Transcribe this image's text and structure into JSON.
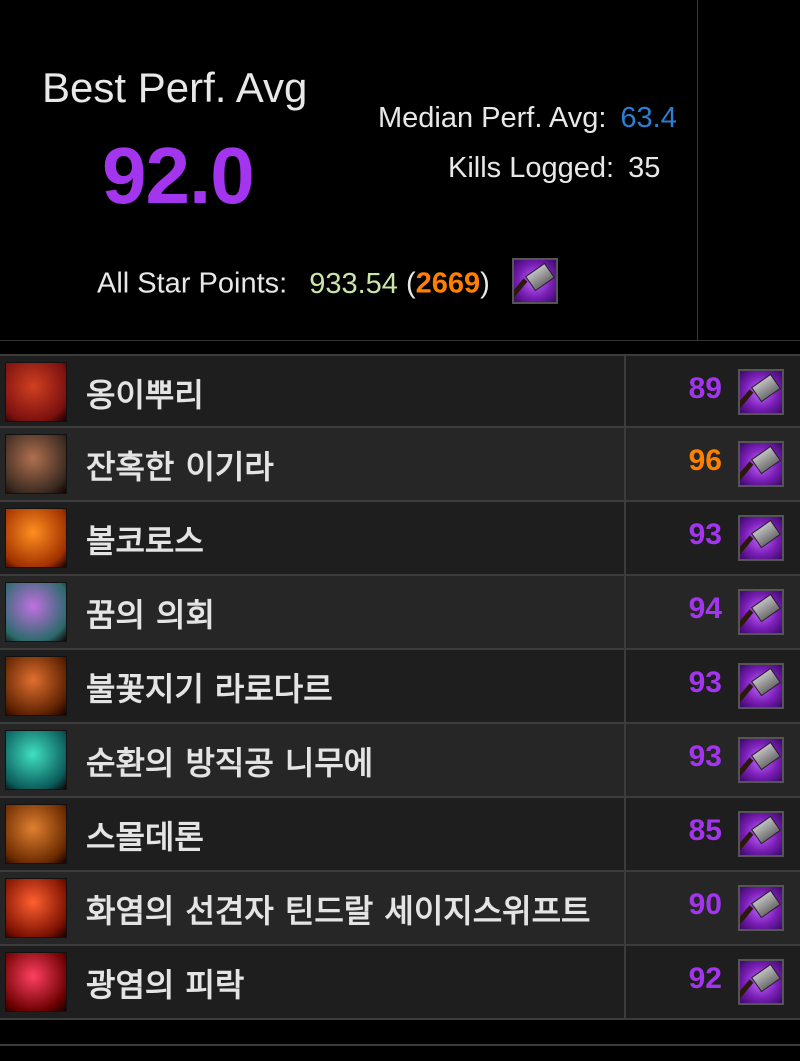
{
  "header": {
    "best_label": "Best Perf. Avg",
    "best_value": "92.0",
    "median_label": "Median Perf. Avg:",
    "median_value": "63.4",
    "kills_label": "Kills Logged:",
    "kills_value": "35",
    "asp_label": "All Star Points:",
    "asp_points": "933.54",
    "asp_rank": "2669",
    "asp_open": "(",
    "asp_close": ")",
    "spec_icon": "hammer-icon"
  },
  "colors": {
    "legendary": "#ff8000",
    "epic": "#a335ee",
    "rare": "#2a7fd4",
    "points": "#c9e6a8"
  },
  "bosses": [
    {
      "name": "옹이뿌리",
      "score": "89",
      "color": "#a335ee",
      "icon": "boss-portrait-icon"
    },
    {
      "name": "잔혹한 이기라",
      "score": "96",
      "color": "#ff8000",
      "icon": "boss-portrait-icon"
    },
    {
      "name": "볼코로스",
      "score": "93",
      "color": "#a335ee",
      "icon": "boss-portrait-icon"
    },
    {
      "name": "꿈의 의회",
      "score": "94",
      "color": "#a335ee",
      "icon": "boss-portrait-icon"
    },
    {
      "name": "불꽃지기 라로다르",
      "score": "93",
      "color": "#a335ee",
      "icon": "boss-portrait-icon"
    },
    {
      "name": "순환의 방직공 니무에",
      "score": "93",
      "color": "#a335ee",
      "icon": "boss-portrait-icon"
    },
    {
      "name": "스몰데론",
      "score": "85",
      "color": "#a335ee",
      "icon": "boss-portrait-icon"
    },
    {
      "name": "화염의 선견자 틴드랄 세이지스위프트",
      "score": "90",
      "color": "#a335ee",
      "icon": "boss-portrait-icon"
    },
    {
      "name": "광염의 피락",
      "score": "92",
      "color": "#a335ee",
      "icon": "boss-portrait-icon"
    }
  ]
}
